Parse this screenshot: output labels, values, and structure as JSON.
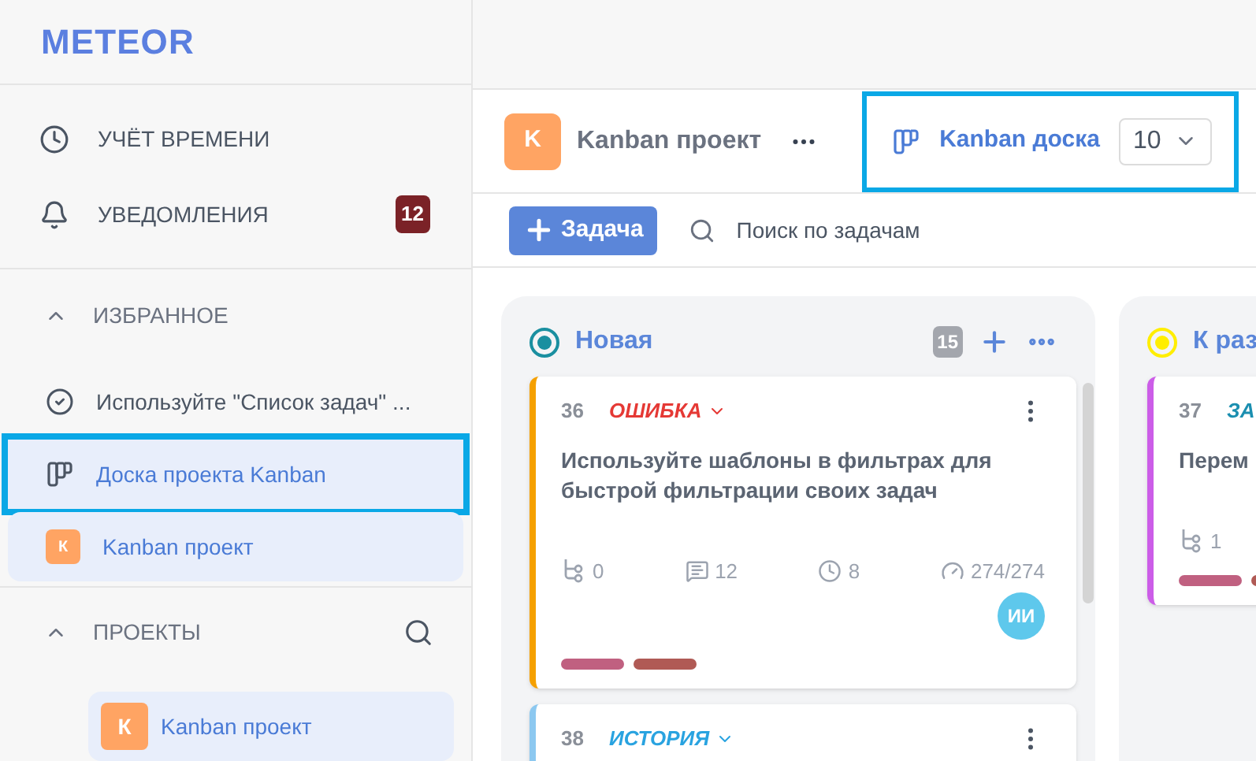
{
  "logo": "METEOR",
  "sidebar": {
    "nav": [
      {
        "kind": "clock",
        "label": "УЧЁТ ВРЕМЕНИ"
      },
      {
        "kind": "bell",
        "label": "УВЕДОМЛЕНИЯ",
        "badge": "12"
      }
    ],
    "favorites": {
      "title": "ИЗБРАННОЕ",
      "expanded": true,
      "items": [
        {
          "kind": "task",
          "label": "Используйте \"Список задач\" ...",
          "selected": false,
          "highlighted": false
        },
        {
          "kind": "board",
          "label": "Доска проекта Kanban",
          "selected": true,
          "highlighted": true
        },
        {
          "kind": "project",
          "label": "Kanban проект",
          "avatar": "К",
          "selected": true,
          "highlighted": false
        }
      ]
    },
    "projects": {
      "title": "ПРОЕКТЫ",
      "expanded": true,
      "items": [
        {
          "label": "Kanban проект",
          "avatar": "К",
          "selected": true
        }
      ]
    }
  },
  "header": {
    "project": {
      "avatar": "K",
      "title": "Kanban проект"
    },
    "view": {
      "label": "Kanban доска",
      "value": "10",
      "highlighted": true
    }
  },
  "toolbar": {
    "add_button": "Задача",
    "search": {
      "placeholder": "Поиск по задачам"
    }
  },
  "columns": [
    {
      "title": "Новая",
      "color": "#1a8fa0",
      "count": "15",
      "cards": [
        {
          "number": "36",
          "type": {
            "label": "ОШИБКА",
            "color": "#e53935",
            "dropdown": true
          },
          "menu": true,
          "color": "#f5a000",
          "title": "Используйте шаблоны в фильтрах для быстрой фильтрации своих задач",
          "stats": [
            {
              "kind": "subtasks",
              "value": "0"
            },
            {
              "kind": "comments",
              "value": "12"
            },
            {
              "kind": "time",
              "value": "8"
            },
            {
              "kind": "progress",
              "value": "274/274"
            }
          ],
          "avatar": "ИИ",
          "tags": [
            {
              "color": "#c06080"
            },
            {
              "color": "#b05a55"
            }
          ]
        },
        {
          "number": "38",
          "type": {
            "label": "ИСТОРИЯ",
            "color": "#29a3e0",
            "dropdown": true
          },
          "menu": true,
          "color": "#8cc8f0"
        }
      ]
    },
    {
      "title": "К раз",
      "color": "#ffee00",
      "cards": [
        {
          "number": "37",
          "type": {
            "label": "ЗА",
            "color": "#1b8fb0"
          },
          "color": "#cc5de8",
          "title": "Перем",
          "stats": [
            {
              "kind": "subtasks",
              "value": "1"
            }
          ],
          "tags": [
            {
              "color": "#c06080"
            },
            {
              "color": "#b05a55"
            }
          ]
        }
      ]
    }
  ]
}
